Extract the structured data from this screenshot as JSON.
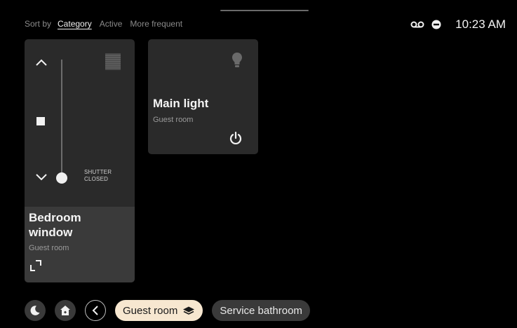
{
  "sort": {
    "label": "Sort by",
    "options": [
      "Category",
      "Active",
      "More frequent"
    ],
    "selected": "Category"
  },
  "status": {
    "time": "10:23 AM",
    "icons": [
      "voicemail-icon",
      "do-not-disturb-icon"
    ]
  },
  "devices": [
    {
      "type": "shutter",
      "name_line1": "Bedroom",
      "name_line2": "window",
      "room": "Guest room",
      "state_line1": "SHUTTER",
      "state_line2": "CLOSED",
      "position": 0
    },
    {
      "type": "light",
      "name": "Main light",
      "room": "Guest room"
    }
  ],
  "bottom_bar": {
    "rooms": [
      "Guest room",
      "Service bathroom"
    ],
    "selected_room": "Guest room"
  },
  "colors": {
    "background": "#000000",
    "card": "#2a2a2a",
    "card_footer": "#3a3a3a",
    "selected_chip": "#f7e7d0"
  }
}
